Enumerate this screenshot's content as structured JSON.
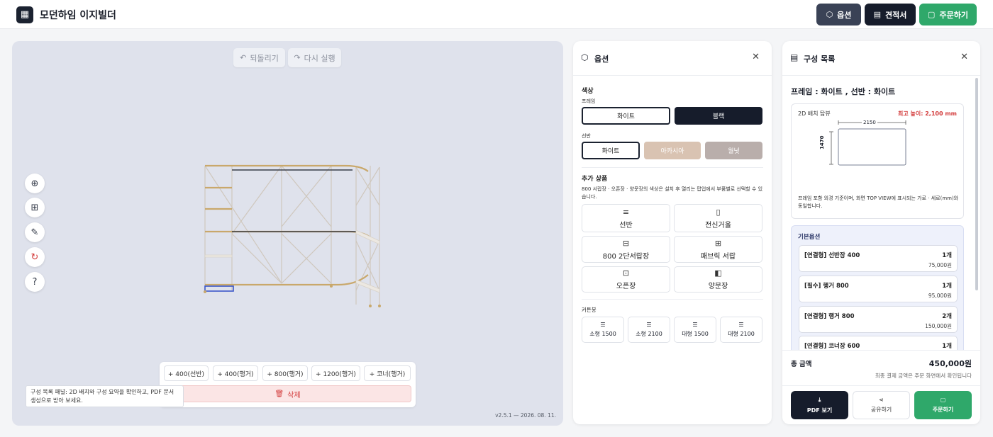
{
  "header": {
    "app_title": "모던하임 이지빌더",
    "logo_icon": "grid-icon",
    "buttons": [
      {
        "label": "옵션",
        "icon": "cube-icon",
        "color": "#3a4256"
      },
      {
        "label": "견적서",
        "icon": "receipt-icon",
        "color": "#161c2b"
      },
      {
        "label": "주문하기",
        "icon": "cart-icon",
        "color": "#2fa86a"
      }
    ]
  },
  "viewer": {
    "undo_label": "되돌리기",
    "redo_label": "다시 실행",
    "tools": [
      "zoom-in-icon",
      "grid-view-icon",
      "measure-icon",
      "reset-icon",
      "help-icon"
    ],
    "add_buttons": [
      "+ 400(선반)",
      "+ 400(행거)",
      "+ 800(행거)",
      "+ 1200(행거)",
      "+ 코너(행거)"
    ],
    "delete_label": "삭제",
    "tooltip": "구성 목록 패널: 2D 배치와 구성 요약을 확인하고, PDF 문서 생성으로 받아 보세요.",
    "version": "v2.5.1 — 2026. 08. 11."
  },
  "options_panel": {
    "title": "옵션",
    "color_section": "색상",
    "frame_label": "프레임",
    "frame_options": [
      {
        "label": "화이트",
        "selected": true
      },
      {
        "label": "블랙",
        "selected": false
      }
    ],
    "shelf_label": "선반",
    "shelf_options": [
      {
        "label": "화이트",
        "selected": true
      },
      {
        "label": "아카시아",
        "selected": false
      },
      {
        "label": "월넛",
        "selected": false
      }
    ],
    "extra_section": "추가 상품",
    "extra_desc": "800 서랍장 · 오픈장 · 양문장의 색상은 설치 후 열리는 팝업에서 부품별로 선택할 수 있습니다.",
    "extra_items": [
      {
        "label": "선반",
        "icon": "shelf-icon"
      },
      {
        "label": "전신거울",
        "icon": "mirror-icon"
      },
      {
        "label": "800 2단서랍장",
        "icon": "drawer-icon"
      },
      {
        "label": "패브릭 서랍",
        "icon": "fabric-drawer-icon"
      },
      {
        "label": "오픈장",
        "icon": "open-cabinet-icon"
      },
      {
        "label": "양문장",
        "icon": "double-door-icon"
      }
    ],
    "curtain_section": "커튼봉",
    "curtain_items": [
      "소형 1500",
      "소형 2100",
      "대형 1500",
      "대형 2100"
    ]
  },
  "list_panel": {
    "title": "구성 목록",
    "summary": "프레임 : 화이트 , 선반 : 화이트",
    "layout_label": "2D 배치 탑뷰",
    "max_height": "최고 높이: 2,100 mm",
    "dim_width": "2150",
    "dim_depth": "1470",
    "layout_note": "프레임 포함 외경 기준이며, 화면 TOP VIEW에 표시되는 가로 · 세로(mm)와 동일합니다.",
    "basic_options_title": "기본옵션",
    "items": [
      {
        "name": "[연결형] 선반장 400",
        "qty": "1개",
        "price": "75,000원"
      },
      {
        "name": "[필수] 행거 800",
        "qty": "1개",
        "price": "95,000원"
      },
      {
        "name": "[연결형] 행거 800",
        "qty": "2개",
        "price": "150,000원"
      },
      {
        "name": "[연결형] 코너장 600",
        "qty": "1개",
        "price": ""
      }
    ],
    "total_label": "총 금액",
    "total_value": "450,000원",
    "total_note": "최종 결제 금액은 주문 화면에서 확인됩니다",
    "actions": [
      {
        "label": "PDF 보기",
        "icon": "download-icon"
      },
      {
        "label": "공유하기",
        "icon": "share-icon"
      },
      {
        "label": "주문하기",
        "icon": "cart-icon"
      }
    ]
  },
  "colors": {
    "accent_dark": "#161c2b",
    "accent_green": "#2fa86a",
    "danger": "#d33b3b",
    "acacia": "#d9c3b2",
    "walnut": "#b9aeab"
  }
}
